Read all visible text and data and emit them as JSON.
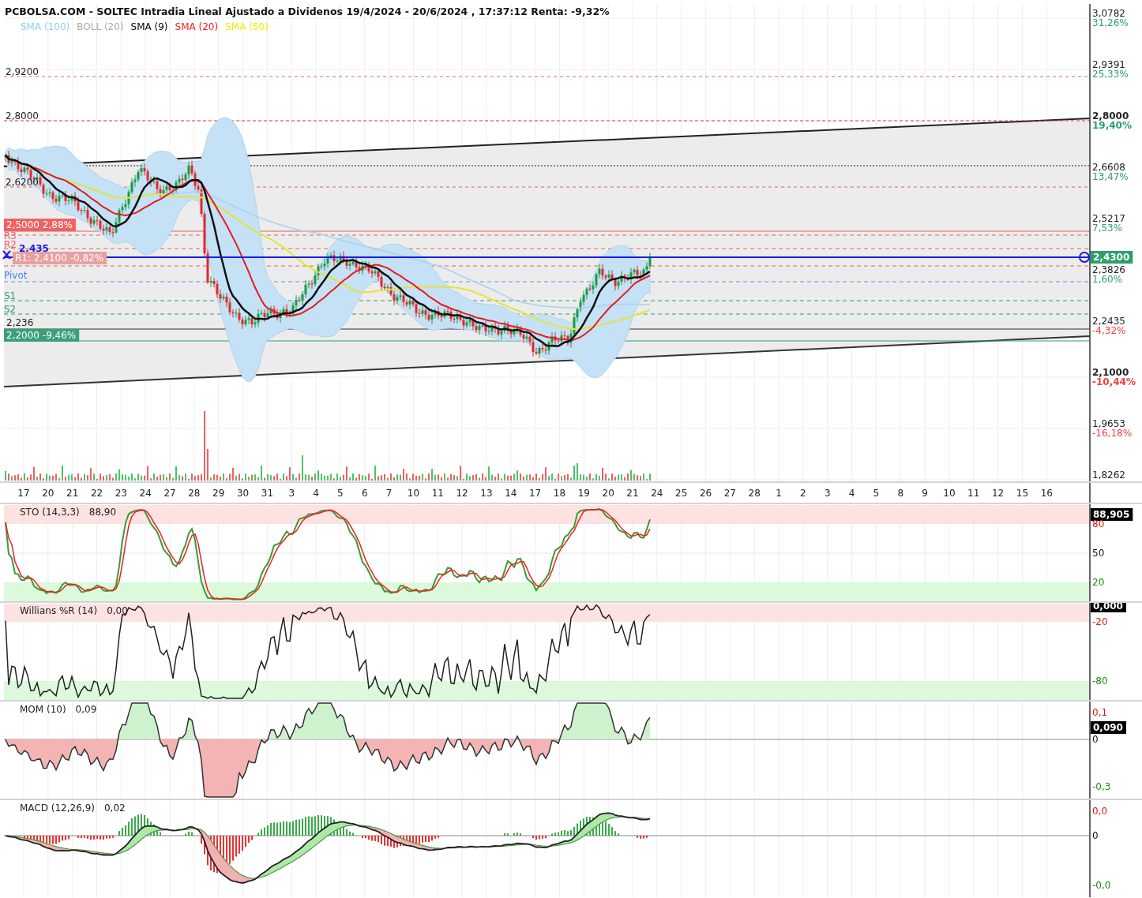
{
  "title": "PCBOLSA.COM - SOLTEC Intradia Lineal Ajustado a Dividenos 19/4/2024 - 20/6/2024 , 17:37:12 Renta: -9,32%",
  "legend": [
    {
      "label": "SMA (100)",
      "color": "#8ecdf5"
    },
    {
      "label": "BOLL (20)",
      "color": "#a9a9a9"
    },
    {
      "label": "SMA (9)",
      "color": "#000000"
    },
    {
      "label": "SMA (20)",
      "color": "#ee1c1c"
    },
    {
      "label": "SMA (50)",
      "color": "#eeee00"
    }
  ],
  "grid_labels": [
    "2,9200",
    "2,8000",
    "2,6200"
  ],
  "levels": [
    {
      "kind": "tag",
      "label": "2,5000  2,88%",
      "color": "#f06262"
    },
    {
      "kind": "label",
      "label": "R3",
      "color": "#f06262"
    },
    {
      "kind": "label",
      "label": "R2",
      "color": "#f06262"
    },
    {
      "kind": "marker",
      "label": "2,435",
      "color": "#1a1ae6"
    },
    {
      "kind": "tag",
      "label": "R1: 2,4100  -0,82%",
      "color": "#e8a0a0"
    },
    {
      "kind": "label",
      "label": "Pivot",
      "color": "#3a86e0"
    },
    {
      "kind": "label",
      "label": "S1",
      "color": "#2e9e6a"
    },
    {
      "kind": "label",
      "label": "S2",
      "color": "#2e9e6a"
    },
    {
      "kind": "label",
      "label": "2,236",
      "color": "#222222"
    },
    {
      "kind": "tag",
      "label": "2,2000  -9,46%",
      "color": "#3aa077"
    }
  ],
  "price_axis": [
    {
      "price": "3,0782",
      "change": "31,26%",
      "color": "#2e9e6a",
      "emphasis": false
    },
    {
      "price": "2,9391",
      "change": "25,33%",
      "color": "#2e9e6a",
      "emphasis": false
    },
    {
      "price": "2,8000",
      "change": "19,40%",
      "color": "#2e9e6a",
      "emphasis": true
    },
    {
      "price": "2,6608",
      "change": "13,47%",
      "color": "#2e9e6a",
      "emphasis": false
    },
    {
      "price": "2,5217",
      "change": "7,53%",
      "color": "#2e9e6a",
      "emphasis": false
    },
    {
      "price": "2,3826",
      "change": "1,60%",
      "color": "#2e9e6a",
      "emphasis": false
    },
    {
      "price": "2,2435",
      "change": "-4,32%",
      "color": "#f04040",
      "emphasis": false
    },
    {
      "price": "2,1000",
      "change": "-10,44%",
      "color": "#f04040",
      "emphasis": true
    },
    {
      "price": "1,9653",
      "change": "-16,18%",
      "color": "#f04040",
      "emphasis": false
    },
    {
      "price": "1,8262",
      "emphasis": false
    }
  ],
  "last_price": "2,4300",
  "dates": [
    "17",
    "20",
    "21",
    "22",
    "23",
    "24",
    "27",
    "28",
    "29",
    "30",
    "31",
    "3",
    "4",
    "5",
    "6",
    "7",
    "10",
    "11",
    "12",
    "13",
    "14",
    "17",
    "18",
    "19",
    "20",
    "21",
    "24",
    "25",
    "26",
    "27",
    "28",
    "1",
    "2",
    "3",
    "4",
    "5",
    "8",
    "9",
    "10",
    "11",
    "12",
    "15",
    "16"
  ],
  "panels": [
    {
      "kind": "sto",
      "title": "STO (14,3,3)",
      "value": "88,90",
      "axis": [
        {
          "label": "88,905",
          "kind": "tag"
        },
        {
          "label": "80",
          "kind": "upper"
        },
        {
          "label": "50",
          "kind": "mid"
        },
        {
          "label": "20",
          "kind": "lower"
        }
      ]
    },
    {
      "kind": "williams",
      "title": "Willians %R (14)",
      "value": "0,00",
      "axis": [
        {
          "label": "0,000",
          "kind": "tag"
        },
        {
          "label": "-20",
          "kind": "upper"
        },
        {
          "label": "-80",
          "kind": "lower"
        }
      ]
    },
    {
      "kind": "momentum",
      "title": "MOM (10)",
      "value": "0,09",
      "axis": [
        {
          "label": "0,1",
          "kind": "upper"
        },
        {
          "label": "0,090",
          "kind": "tag"
        },
        {
          "label": "0",
          "kind": "mid"
        },
        {
          "label": "-0,3",
          "kind": "lower"
        }
      ]
    },
    {
      "kind": "macd",
      "title": "MACD (12,26,9)",
      "value": "0,02",
      "axis": [
        {
          "label": "0,0",
          "kind": "upper"
        },
        {
          "label": "0",
          "kind": "mid"
        },
        {
          "label": "-0,0",
          "kind": "lower"
        }
      ]
    }
  ]
}
